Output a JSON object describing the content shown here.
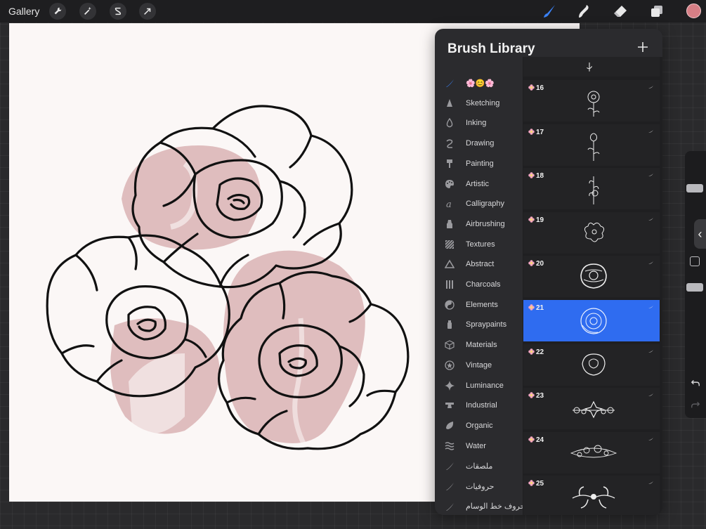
{
  "topbar": {
    "gallery_label": "Gallery",
    "tools_left": [
      "wrench-icon",
      "magic-wand-icon",
      "selection-s-icon",
      "transform-arrow-icon"
    ],
    "tools_right": [
      "brush-icon",
      "smudge-icon",
      "eraser-icon",
      "layers-icon"
    ],
    "active_color": "#d77f86"
  },
  "brush_library": {
    "title": "Brush Library",
    "categories": [
      {
        "label": "🌸😊🌸",
        "icon": "brush-stroke-icon",
        "active": true
      },
      {
        "label": "Sketching",
        "icon": "pencil-tip-icon"
      },
      {
        "label": "Inking",
        "icon": "ink-drop-icon"
      },
      {
        "label": "Drawing",
        "icon": "squiggle-icon"
      },
      {
        "label": "Painting",
        "icon": "paint-roller-icon"
      },
      {
        "label": "Artistic",
        "icon": "palette-icon"
      },
      {
        "label": "Calligraphy",
        "icon": "calligraphy-a-icon"
      },
      {
        "label": "Airbrushing",
        "icon": "airbrush-icon"
      },
      {
        "label": "Textures",
        "icon": "texture-icon"
      },
      {
        "label": "Abstract",
        "icon": "triangle-icon"
      },
      {
        "label": "Charcoals",
        "icon": "charcoal-icon"
      },
      {
        "label": "Elements",
        "icon": "yin-yang-icon"
      },
      {
        "label": "Spraypaints",
        "icon": "spray-can-icon"
      },
      {
        "label": "Materials",
        "icon": "cube-icon"
      },
      {
        "label": "Vintage",
        "icon": "star-badge-icon"
      },
      {
        "label": "Luminance",
        "icon": "sparkle-icon"
      },
      {
        "label": "Industrial",
        "icon": "anvil-icon"
      },
      {
        "label": "Organic",
        "icon": "leaf-icon"
      },
      {
        "label": "Water",
        "icon": "waves-icon"
      },
      {
        "label": "ملصقات",
        "icon": "brush-stroke-icon"
      },
      {
        "label": "حروفيات",
        "icon": "brush-stroke-icon"
      },
      {
        "label": "حروف خط الوسام",
        "icon": "brush-stroke-icon"
      }
    ],
    "brushes": [
      {
        "num": "16",
        "selected": false
      },
      {
        "num": "17",
        "selected": false
      },
      {
        "num": "18",
        "selected": false
      },
      {
        "num": "19",
        "selected": false
      },
      {
        "num": "20",
        "selected": false
      },
      {
        "num": "21",
        "selected": true
      },
      {
        "num": "22",
        "selected": false
      },
      {
        "num": "23",
        "selected": false
      },
      {
        "num": "24",
        "selected": false
      },
      {
        "num": "25",
        "selected": false
      }
    ]
  },
  "colors": {
    "accent": "#2f6cf0",
    "rose_fill": "#dcb7b9",
    "panel_bg": "#2b2b2e"
  }
}
